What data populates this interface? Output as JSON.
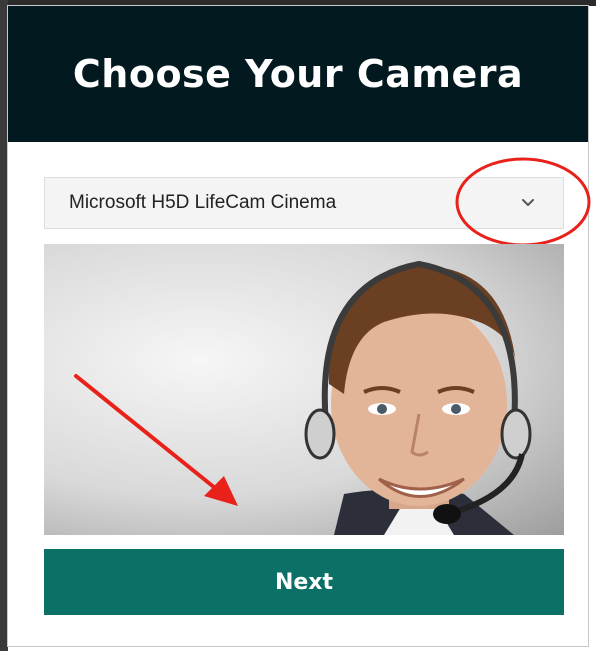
{
  "dialog": {
    "title": "Choose Your Camera"
  },
  "camera_select": {
    "selected": "Microsoft H5D LifeCam Cinema",
    "icon": "chevron-down-icon"
  },
  "preview": {
    "image": "camera-preview-person-with-headset"
  },
  "annotations": {
    "circle_color": "#e8221b",
    "arrow_color": "#e8221b"
  },
  "actions": {
    "next_label": "Next"
  },
  "colors": {
    "header_bg": "#021a1f",
    "button_bg": "#0b7166",
    "select_bg": "#f4f4f4"
  }
}
